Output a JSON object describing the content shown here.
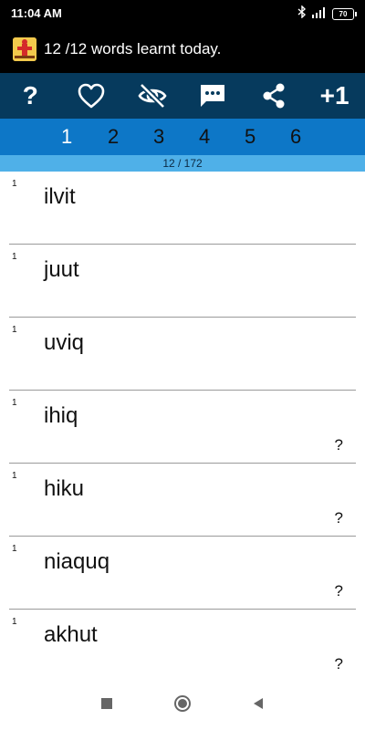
{
  "status_bar": {
    "time": "11:04 AM",
    "battery": "70",
    "icons": [
      "bluetooth-icon",
      "signal-icon",
      "battery-icon"
    ]
  },
  "header": {
    "title": "12 /12 words learnt today.",
    "logo_icon": "app-logo-icon"
  },
  "toolbar": {
    "help_label": "?",
    "favorite_icon": "heart-icon",
    "hide_icon": "eye-off-icon",
    "comment_icon": "comment-icon",
    "share_icon": "share-icon",
    "plus_label": "+1"
  },
  "tabs": [
    "1",
    "2",
    "3",
    "4",
    "5",
    "6"
  ],
  "progress": "12 / 172",
  "words": [
    {
      "num": "1",
      "word": "ilvit",
      "mark": ""
    },
    {
      "num": "1",
      "word": "juut",
      "mark": ""
    },
    {
      "num": "1",
      "word": "uviq",
      "mark": ""
    },
    {
      "num": "1",
      "word": "ihiq",
      "mark": "?"
    },
    {
      "num": "1",
      "word": "hiku",
      "mark": "?"
    },
    {
      "num": "1",
      "word": "niaquq",
      "mark": "?"
    },
    {
      "num": "1",
      "word": "akhut",
      "mark": "?"
    }
  ],
  "colors": {
    "toolbar": "#063a5d",
    "tabs": "#0d77c7",
    "progress": "#4fb0e8"
  }
}
